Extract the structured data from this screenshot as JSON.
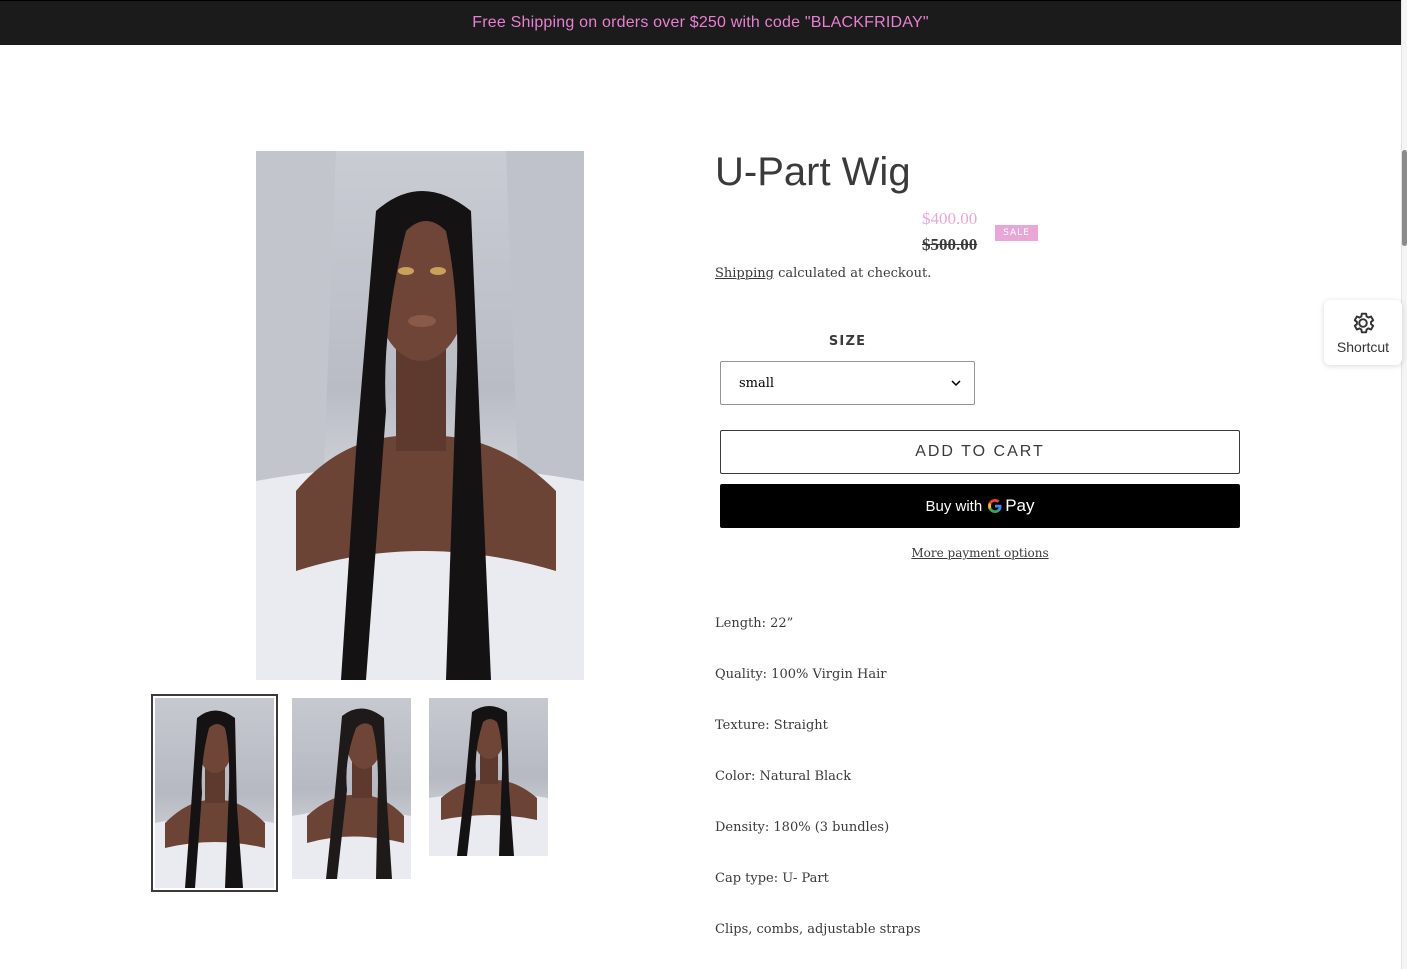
{
  "announcement": {
    "text": "Free Shipping on orders over $250 with code \"BLACKFRIDAY\""
  },
  "product": {
    "title": "U-Part Wig",
    "price_sale": "$400.00",
    "price_regular": "$500.00",
    "sale_badge": "SALE",
    "shipping_link": "Shipping",
    "shipping_text": " calculated at checkout."
  },
  "size": {
    "label": "SIZE",
    "selected": "small"
  },
  "buttons": {
    "add_to_cart": "ADD TO CART",
    "buy_with": "Buy with",
    "pay_brand": "Pay",
    "more_payment_options": "More payment options"
  },
  "description": [
    "Length: 22”",
    "Quality: 100% Virgin Hair",
    "Texture: Straight",
    "Color: Natural Black",
    "Density: 180% (3 bundles)",
    "Cap type: U- Part",
    "Clips, combs, adjustable straps"
  ],
  "shortcut": {
    "label": "Shortcut"
  },
  "colors": {
    "announcement_bg": "#1c1b1b",
    "announcement_text": "#e87fd3",
    "sale_accent": "#e9a7d8",
    "text": "#3a3a3a"
  }
}
